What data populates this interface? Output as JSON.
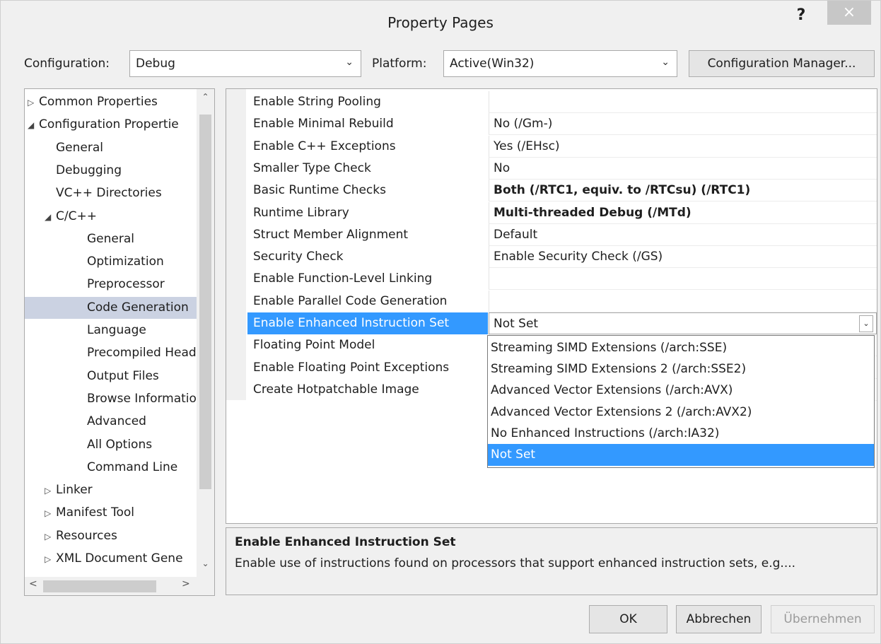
{
  "window": {
    "title": "Property Pages",
    "help": "?",
    "close": "×"
  },
  "config": {
    "configuration_label": "Configuration:",
    "configuration_value": "Debug",
    "platform_label": "Platform:",
    "platform_value": "Active(Win32)",
    "manager_button": "Configuration Manager..."
  },
  "tree": [
    {
      "label": "Common Properties",
      "expander": "▷",
      "level": 0
    },
    {
      "label": "Configuration Propertie",
      "expander": "◢",
      "level": 0
    },
    {
      "label": "General",
      "expander": "",
      "level": 1
    },
    {
      "label": "Debugging",
      "expander": "",
      "level": 1
    },
    {
      "label": "VC++ Directories",
      "expander": "",
      "level": 1
    },
    {
      "label": "C/C++",
      "expander": "◢",
      "level": 1
    },
    {
      "label": "General",
      "expander": "",
      "level": 2
    },
    {
      "label": "Optimization",
      "expander": "",
      "level": 2
    },
    {
      "label": "Preprocessor",
      "expander": "",
      "level": 2
    },
    {
      "label": "Code Generation",
      "expander": "",
      "level": 2,
      "selected": true
    },
    {
      "label": "Language",
      "expander": "",
      "level": 2
    },
    {
      "label": "Precompiled Head",
      "expander": "",
      "level": 2
    },
    {
      "label": "Output Files",
      "expander": "",
      "level": 2
    },
    {
      "label": "Browse Informatio",
      "expander": "",
      "level": 2
    },
    {
      "label": "Advanced",
      "expander": "",
      "level": 2
    },
    {
      "label": "All Options",
      "expander": "",
      "level": 2
    },
    {
      "label": "Command Line",
      "expander": "",
      "level": 2
    },
    {
      "label": "Linker",
      "expander": "▷",
      "level": 1
    },
    {
      "label": "Manifest Tool",
      "expander": "▷",
      "level": 1
    },
    {
      "label": "Resources",
      "expander": "▷",
      "level": 1
    },
    {
      "label": "XML Document Gene",
      "expander": "▷",
      "level": 1
    }
  ],
  "properties": [
    {
      "name": "Enable String Pooling",
      "value": ""
    },
    {
      "name": "Enable Minimal Rebuild",
      "value": "No (/Gm-)"
    },
    {
      "name": "Enable C++ Exceptions",
      "value": "Yes (/EHsc)"
    },
    {
      "name": "Smaller Type Check",
      "value": "No"
    },
    {
      "name": "Basic Runtime Checks",
      "value": "Both (/RTC1, equiv. to /RTCsu) (/RTC1)",
      "bold": true
    },
    {
      "name": "Runtime Library",
      "value": "Multi-threaded Debug (/MTd)",
      "bold": true
    },
    {
      "name": "Struct Member Alignment",
      "value": "Default"
    },
    {
      "name": "Security Check",
      "value": "Enable Security Check (/GS)"
    },
    {
      "name": "Enable Function-Level Linking",
      "value": ""
    },
    {
      "name": "Enable Parallel Code Generation",
      "value": ""
    },
    {
      "name": "Enable Enhanced Instruction Set",
      "value": "Not Set",
      "selected": true
    },
    {
      "name": "Floating Point Model",
      "value": ""
    },
    {
      "name": "Enable Floating Point Exceptions",
      "value": ""
    },
    {
      "name": "Create Hotpatchable Image",
      "value": ""
    }
  ],
  "dropdown": {
    "options": [
      "Streaming SIMD Extensions (/arch:SSE)",
      "Streaming SIMD Extensions 2 (/arch:SSE2)",
      "Advanced Vector Extensions (/arch:AVX)",
      "Advanced Vector Extensions 2 (/arch:AVX2)",
      "No Enhanced Instructions (/arch:IA32)",
      "Not Set"
    ],
    "selected_index": 5
  },
  "description": {
    "title": "Enable Enhanced Instruction Set",
    "text": "Enable use of instructions found on processors that support enhanced instruction sets, e.g...."
  },
  "buttons": {
    "ok": "OK",
    "cancel": "Abbrechen",
    "apply": "Übernehmen"
  },
  "colors": {
    "selection": "#3399ff",
    "tree_selection": "#cbd2e2",
    "dialog_bg": "#f0f0f0"
  }
}
